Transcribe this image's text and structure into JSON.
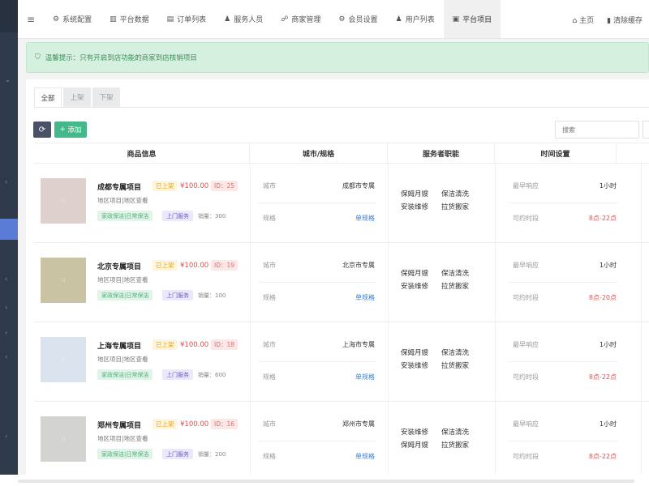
{
  "topnav": {
    "items": [
      {
        "icon": "gear-icon",
        "glyph": "⚙",
        "label": "系统配置"
      },
      {
        "icon": "bar-chart-icon",
        "glyph": "▥",
        "label": "平台数据"
      },
      {
        "icon": "list-icon",
        "glyph": "▤",
        "label": "订单列表"
      },
      {
        "icon": "person-icon",
        "glyph": "♟",
        "label": "服务人员"
      },
      {
        "icon": "handshake-icon",
        "glyph": "☍",
        "label": "商家管理"
      },
      {
        "icon": "gear-icon",
        "glyph": "⚙",
        "label": "会员设置"
      },
      {
        "icon": "person-icon",
        "glyph": "♟",
        "label": "用户列表"
      },
      {
        "icon": "bag-icon",
        "glyph": "▣",
        "label": "平台项目"
      }
    ],
    "active_index": 7,
    "right": [
      {
        "icon": "home-icon",
        "glyph": "⌂",
        "label": "主页"
      },
      {
        "icon": "trash-icon",
        "glyph": "▮",
        "label": "清除缓存"
      }
    ]
  },
  "tip": {
    "text": "温馨提示：只有开启到店功能的商家到店核销项目"
  },
  "tabs": [
    {
      "label": "全部",
      "active": true
    },
    {
      "label": "上架",
      "active": false
    },
    {
      "label": "下架",
      "active": false
    }
  ],
  "toolbar": {
    "add_label": "添加",
    "search_placeholder": "搜索"
  },
  "table": {
    "headers": [
      "商品信息",
      "城市/规格",
      "服务者职能",
      "时间设置"
    ],
    "rows": [
      {
        "name": "成都专属项目",
        "status": "已上架",
        "price": "¥100.00",
        "id": "ID：25",
        "sub": "地区项目|地区查看",
        "tag1": "家政保洁|日常保洁",
        "tag2": "上门服务",
        "sales": "销量：300",
        "thumb_color": "#ddd0cd",
        "city_key": "城市",
        "city": "成都市专属",
        "spec_key": "规格",
        "spec": "单规格",
        "skills": [
          "保姆月嫂",
          "保洁清洗",
          "安装维修",
          "拉货搬家"
        ],
        "t1_key": "最早响应",
        "t1": "1小时",
        "t2_key": "可约时段",
        "t2": "8点-22点"
      },
      {
        "name": "北京专属项目",
        "status": "已上架",
        "price": "¥100.00",
        "id": "ID：19",
        "sub": "地区项目|地区查看",
        "tag1": "家政保洁|日常保洁",
        "tag2": "上门服务",
        "sales": "销量：100",
        "thumb_color": "#c9c3a3",
        "city_key": "城市",
        "city": "北京市专属",
        "spec_key": "规格",
        "spec": "单规格",
        "skills": [
          "保姆月嫂",
          "保洁清洗",
          "安装维修",
          "拉货搬家"
        ],
        "t1_key": "最早响应",
        "t1": "1小时",
        "t2_key": "可约时段",
        "t2": "8点-20点"
      },
      {
        "name": "上海专属项目",
        "status": "已上架",
        "price": "¥100.00",
        "id": "ID：18",
        "sub": "地区项目|地区查看",
        "tag1": "家政保洁|日常保洁",
        "tag2": "上门服务",
        "sales": "销量：600",
        "thumb_color": "#dbe3ee",
        "city_key": "城市",
        "city": "上海市专属",
        "spec_key": "规格",
        "spec": "单规格",
        "skills": [
          "保姆月嫂",
          "保洁清洗",
          "安装维修",
          "拉货搬家"
        ],
        "t1_key": "最早响应",
        "t1": "1小时",
        "t2_key": "可约时段",
        "t2": "8点-22点"
      },
      {
        "name": "郑州专属项目",
        "status": "已上架",
        "price": "¥100.00",
        "id": "ID：16",
        "sub": "地区项目|地区查看",
        "tag1": "家政保洁|日常保洁",
        "tag2": "上门服务",
        "sales": "销量：200",
        "thumb_color": "#d3d4d1",
        "city_key": "城市",
        "city": "郑州市专属",
        "spec_key": "规格",
        "spec": "单规格",
        "skills": [
          "安装维修",
          "保洁清洗",
          "保姆月嫂",
          "拉货搬家"
        ],
        "t1_key": "最早响应",
        "t1": "1小时",
        "t2_key": "可约时段",
        "t2": "8点-22点"
      }
    ]
  }
}
